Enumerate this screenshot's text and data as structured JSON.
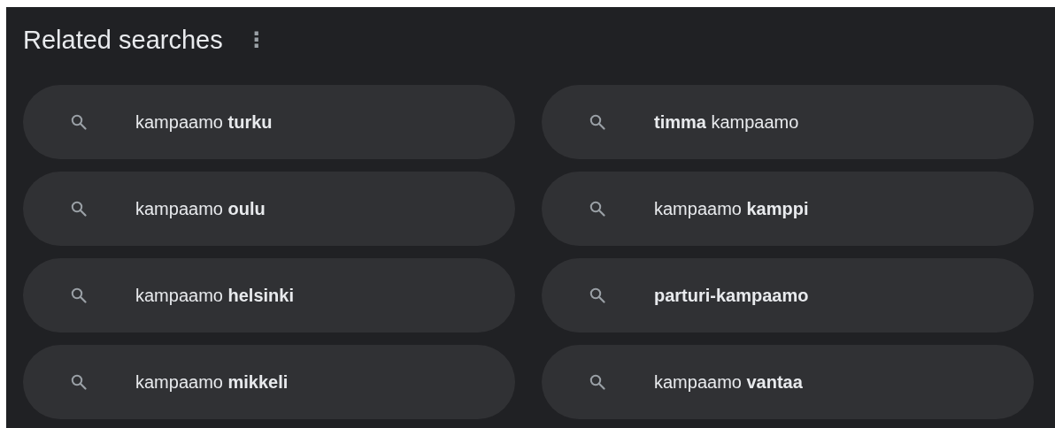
{
  "title": "Related searches",
  "menu_icon": "⋮",
  "searches": [
    {
      "text": "kampaamo **turku**"
    },
    {
      "text": "**timma** kampaamo"
    },
    {
      "text": "kampaamo **oulu**"
    },
    {
      "text": "kampaamo **kamppi**"
    },
    {
      "text": "kampaamo **helsinki**"
    },
    {
      "text": "**parturi-kampaamo**"
    },
    {
      "text": "kampaamo **mikkeli**"
    },
    {
      "text": "kampaamo **vantaa**"
    }
  ]
}
